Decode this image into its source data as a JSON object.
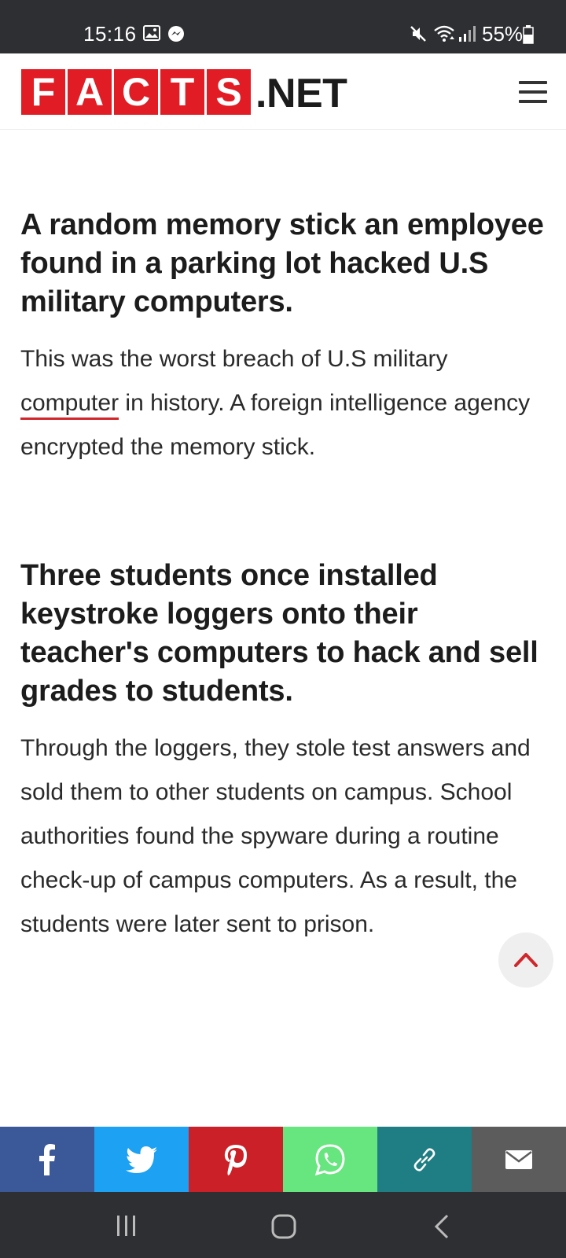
{
  "status_bar": {
    "time": "15:16",
    "battery": "55%",
    "icons": [
      "gallery-icon",
      "messenger-icon",
      "mute-icon",
      "wifi-icon",
      "signal-icon",
      "battery-icon"
    ]
  },
  "header": {
    "logo_letters": [
      "F",
      "A",
      "C",
      "T",
      "S"
    ],
    "logo_suffix": ".NET",
    "brand_color": "#e11c24",
    "menu_icon": "hamburger-menu-icon"
  },
  "facts": [
    {
      "title": "A random memory stick an employee found in a parking lot hacked U.S military computers.",
      "body_before_link": "This was the worst breach of U.S military ",
      "link_text": "computer",
      "body_after_link": " in history. A foreign intelligence agency encrypted the memory stick."
    },
    {
      "title": "Three students once installed keystroke loggers onto their teacher's computers to hack and sell grades to students.",
      "body": "Through the loggers, they stole test answers and sold them to other students on campus. School authorities found the spyware during a routine check-up of campus computers. As a result, the students were later sent to prison."
    }
  ],
  "back_to_top_icon": "chevron-up-icon",
  "share_bar": [
    {
      "network": "facebook",
      "icon": "facebook-icon",
      "color": "#3b5998"
    },
    {
      "network": "twitter",
      "icon": "twitter-icon",
      "color": "#1da1f2"
    },
    {
      "network": "pinterest",
      "icon": "pinterest-icon",
      "color": "#cb2027"
    },
    {
      "network": "whatsapp",
      "icon": "whatsapp-icon",
      "color": "#67e57e"
    },
    {
      "network": "copy-link",
      "icon": "link-icon",
      "color": "#1f7e83"
    },
    {
      "network": "email",
      "icon": "mail-icon",
      "color": "#5c5c5c"
    }
  ],
  "nav_bar": [
    "recent-apps-icon",
    "home-icon",
    "back-icon"
  ]
}
